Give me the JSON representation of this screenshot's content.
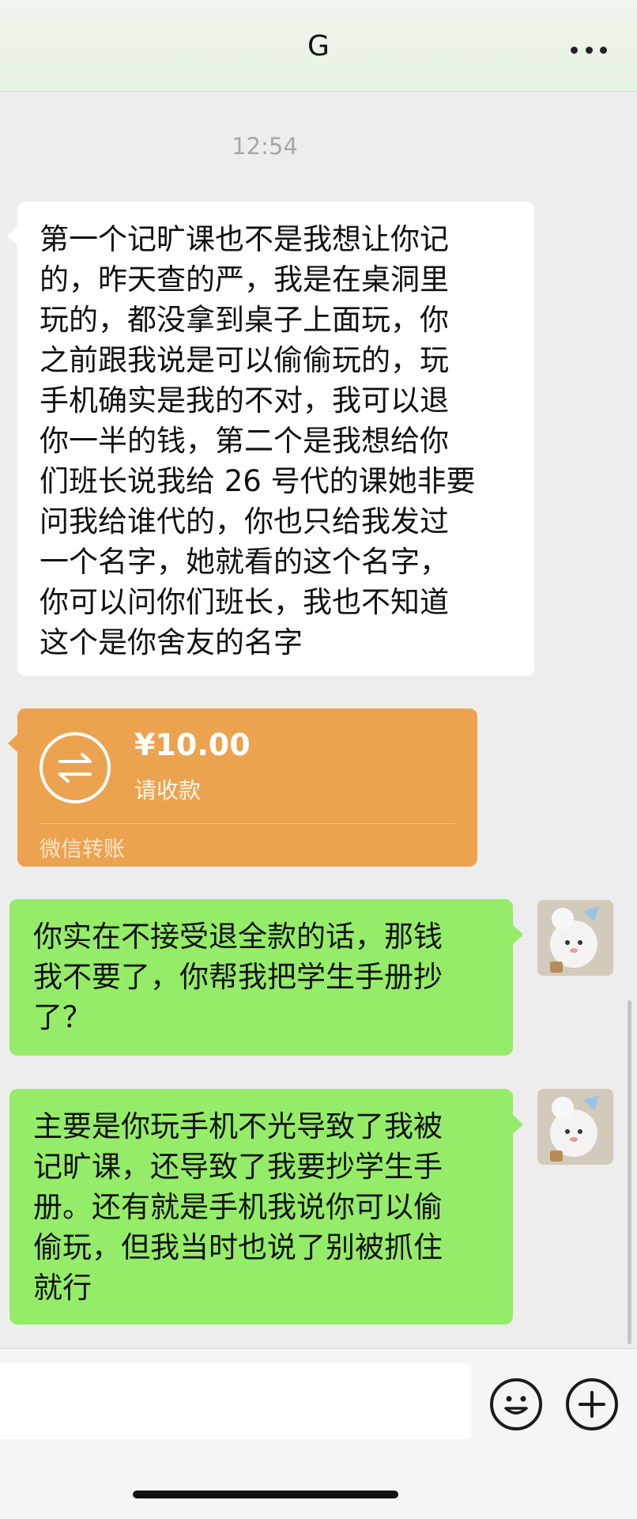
{
  "header": {
    "title": "G"
  },
  "chat": {
    "timestamp": "12:54",
    "incoming_message": "第一个记旷课也不是我想让你记\n的，昨天查的严，我是在桌洞里\n玩的，都没拿到桌子上面玩，你\n之前跟我说是可以偷偷玩的，玩\n手机确实是我的不对，我可以退\n你一半的钱，第二个是我想给你\n们班长说我给 26 号代的课她非要\n问我给谁代的，你也只给我发过\n一个名字，她就看的这个名字，\n你可以问你们班长，我也不知道\n这个是你舍友的名字",
    "transfer": {
      "amount": "¥10.00",
      "status": "请收款",
      "footer": "微信转账",
      "icon": "transfer-arrows-icon"
    },
    "outgoing_messages": [
      "你实在不接受退全款的话，那钱\n我不要了，你帮我把学生手册抄\n了？",
      "主要是你玩手机不光导致了我被\n记旷课，还导致了我要抄学生手\n册。还有就是手机我说你可以偷\n偷玩，但我当时也说了别被抓住\n就行"
    ]
  },
  "composer": {
    "input_value": "",
    "emoji_icon": "emoji-icon",
    "plus_icon": "plus-icon"
  },
  "colors": {
    "background": "#ededed",
    "outgoing_bubble": "#95ec69",
    "incoming_bubble": "#ffffff",
    "transfer_card": "#eca34f"
  }
}
